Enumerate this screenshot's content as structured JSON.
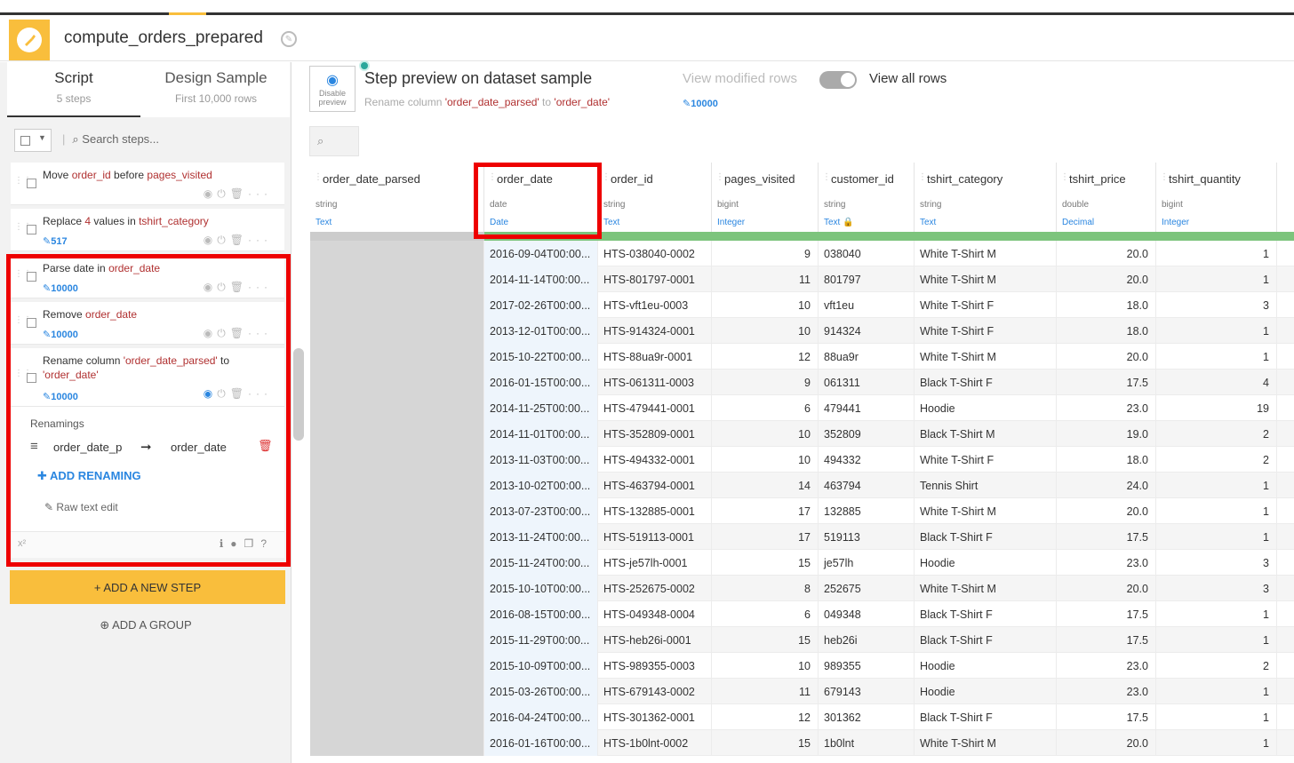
{
  "header": {
    "title": "compute_orders_prepared"
  },
  "left_tabs": {
    "script": {
      "label": "Script",
      "sub": "5 steps"
    },
    "design": {
      "label": "Design Sample",
      "sub": "First 10,000 rows"
    }
  },
  "search": {
    "placeholder": "Search steps..."
  },
  "steps": [
    {
      "pre": "Move ",
      "k1": "order_id",
      "mid": " before ",
      "k2": "pages_visited",
      "count": ""
    },
    {
      "pre": "Replace ",
      "k1": "4",
      "mid": " values in ",
      "k2": "tshirt_category",
      "count": "517"
    },
    {
      "pre": "Parse date",
      "k1": "",
      "mid": " in ",
      "k2": "order_date",
      "count": "10000"
    },
    {
      "pre": "Remove ",
      "k1": "",
      "mid": "",
      "k2": "order_date",
      "count": "10000"
    },
    {
      "pre": "Rename",
      "k1": "",
      "mid": " column ",
      "k2": "'order_date_parsed'",
      "post": " to ",
      "k3": "'order_date'",
      "count": "10000"
    }
  ],
  "renamings": {
    "label": "Renamings",
    "from": "order_date_p",
    "to": "order_date",
    "add_label": "ADD RENAMING",
    "raw_edit": "Raw text edit"
  },
  "footer_sup": "x²",
  "add_step": "+ ADD A NEW STEP",
  "add_group": "ADD A GROUP",
  "preview": {
    "disable_label_1": "Disable",
    "disable_label_2": "preview",
    "title": "Step preview on dataset sample",
    "sub_pre": "Rename column ",
    "sub_k1": "'order_date_parsed'",
    "sub_mid": " to ",
    "sub_k2": "'order_date'",
    "view_modified": "View modified rows",
    "view_all": "View all rows",
    "row_count": "10000"
  },
  "columns": [
    {
      "name": "order_date_parsed",
      "type": "string",
      "meaning": "Text"
    },
    {
      "name": "order_date",
      "type": "date",
      "meaning": "Date"
    },
    {
      "name": "order_id",
      "type": "string",
      "meaning": "Text"
    },
    {
      "name": "pages_visited",
      "type": "bigint",
      "meaning": "Integer"
    },
    {
      "name": "customer_id",
      "type": "string",
      "meaning": "Text"
    },
    {
      "name": "tshirt_category",
      "type": "string",
      "meaning": "Text"
    },
    {
      "name": "tshirt_price",
      "type": "double",
      "meaning": "Decimal"
    },
    {
      "name": "tshirt_quantity",
      "type": "bigint",
      "meaning": "Integer"
    }
  ],
  "rows": [
    [
      "",
      "2016-09-04T00:00...",
      "HTS-038040-0002",
      "9",
      "038040",
      "White T-Shirt M",
      "20.0",
      "1"
    ],
    [
      "",
      "2014-11-14T00:00...",
      "HTS-801797-0001",
      "11",
      "801797",
      "White T-Shirt M",
      "20.0",
      "1"
    ],
    [
      "",
      "2017-02-26T00:00...",
      "HTS-vft1eu-0003",
      "10",
      "vft1eu",
      "White T-Shirt F",
      "18.0",
      "3"
    ],
    [
      "",
      "2013-12-01T00:00...",
      "HTS-914324-0001",
      "10",
      "914324",
      "White T-Shirt F",
      "18.0",
      "1"
    ],
    [
      "",
      "2015-10-22T00:00...",
      "HTS-88ua9r-0001",
      "12",
      "88ua9r",
      "White T-Shirt M",
      "20.0",
      "1"
    ],
    [
      "",
      "2016-01-15T00:00...",
      "HTS-061311-0003",
      "9",
      "061311",
      "Black T-Shirt F",
      "17.5",
      "4"
    ],
    [
      "",
      "2014-11-25T00:00...",
      "HTS-479441-0001",
      "6",
      "479441",
      "Hoodie",
      "23.0",
      "19"
    ],
    [
      "",
      "2014-11-01T00:00...",
      "HTS-352809-0001",
      "10",
      "352809",
      "Black T-Shirt M",
      "19.0",
      "2"
    ],
    [
      "",
      "2013-11-03T00:00...",
      "HTS-494332-0001",
      "10",
      "494332",
      "White T-Shirt F",
      "18.0",
      "2"
    ],
    [
      "",
      "2013-10-02T00:00...",
      "HTS-463794-0001",
      "14",
      "463794",
      "Tennis Shirt",
      "24.0",
      "1"
    ],
    [
      "",
      "2013-07-23T00:00...",
      "HTS-132885-0001",
      "17",
      "132885",
      "White T-Shirt M",
      "20.0",
      "1"
    ],
    [
      "",
      "2013-11-24T00:00...",
      "HTS-519113-0001",
      "17",
      "519113",
      "Black T-Shirt F",
      "17.5",
      "1"
    ],
    [
      "",
      "2015-11-24T00:00...",
      "HTS-je57lh-0001",
      "15",
      "je57lh",
      "Hoodie",
      "23.0",
      "3"
    ],
    [
      "",
      "2015-10-10T00:00...",
      "HTS-252675-0002",
      "8",
      "252675",
      "White T-Shirt M",
      "20.0",
      "3"
    ],
    [
      "",
      "2016-08-15T00:00...",
      "HTS-049348-0004",
      "6",
      "049348",
      "Black T-Shirt F",
      "17.5",
      "1"
    ],
    [
      "",
      "2015-11-29T00:00...",
      "HTS-heb26i-0001",
      "15",
      "heb26i",
      "Black T-Shirt F",
      "17.5",
      "1"
    ],
    [
      "",
      "2015-10-09T00:00...",
      "HTS-989355-0003",
      "10",
      "989355",
      "Hoodie",
      "23.0",
      "2"
    ],
    [
      "",
      "2015-03-26T00:00...",
      "HTS-679143-0002",
      "11",
      "679143",
      "Hoodie",
      "23.0",
      "1"
    ],
    [
      "",
      "2016-04-24T00:00...",
      "HTS-301362-0001",
      "12",
      "301362",
      "Black T-Shirt F",
      "17.5",
      "1"
    ],
    [
      "",
      "2016-01-16T00:00...",
      "HTS-1b0lnt-0002",
      "15",
      "1b0lnt",
      "White T-Shirt M",
      "20.0",
      "1"
    ]
  ],
  "colors": {
    "accent": "#f9be3c",
    "highlight": "#ee0000",
    "link": "#2a86e0",
    "keyword": "#b03030",
    "valid": "#7cc47c"
  }
}
